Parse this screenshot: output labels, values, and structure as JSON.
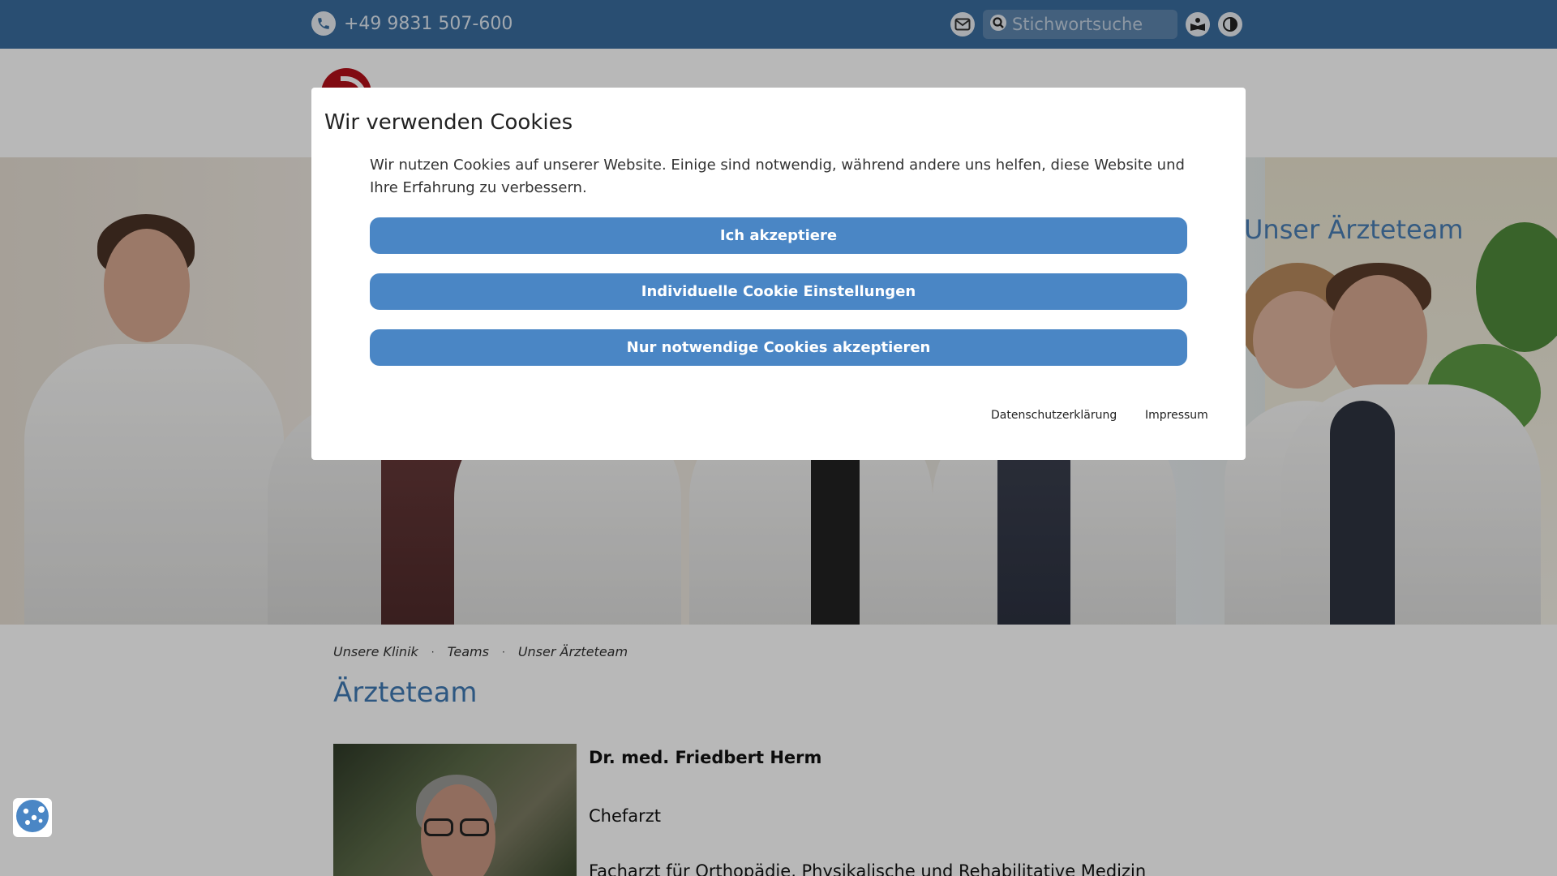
{
  "topbar": {
    "phone": "+49 9831 507-600",
    "search_placeholder": "Stichwortsuche",
    "icons": [
      "phone-icon",
      "mail-icon",
      "search-icon",
      "easy-language-icon",
      "contrast-icon"
    ]
  },
  "hero": {
    "title": "Unser Ärzteteam"
  },
  "breadcrumb": {
    "items": [
      "Unsere Klinik",
      "Teams",
      "Unser Ärzteteam"
    ],
    "separator": "·"
  },
  "page": {
    "title": "Ärzteteam"
  },
  "doctor": {
    "name": "Dr. med. Friedbert Herm",
    "role": "Chefarzt",
    "specialty": "Facharzt für Orthopädie, Physikalische und Rehabilitative Medizin"
  },
  "cookie_modal": {
    "title": "Wir verwenden Cookies",
    "text": "Wir nutzen Cookies auf unserer Website. Einige sind notwendig, während andere uns helfen, diese Website und Ihre Erfahrung zu verbessern.",
    "buttons": {
      "accept": "Ich akzeptiere",
      "individual": "Individuelle Cookie Einstellungen",
      "necessary": "Nur notwendige Cookies akzeptieren"
    },
    "links": {
      "privacy": "Datenschutzerklärung",
      "imprint": "Impressum"
    }
  },
  "colors": {
    "topbar": "#3a6c9e",
    "accent": "#4a86c5",
    "title_blue": "#3f79b3",
    "logo_red": "#b3101a"
  }
}
